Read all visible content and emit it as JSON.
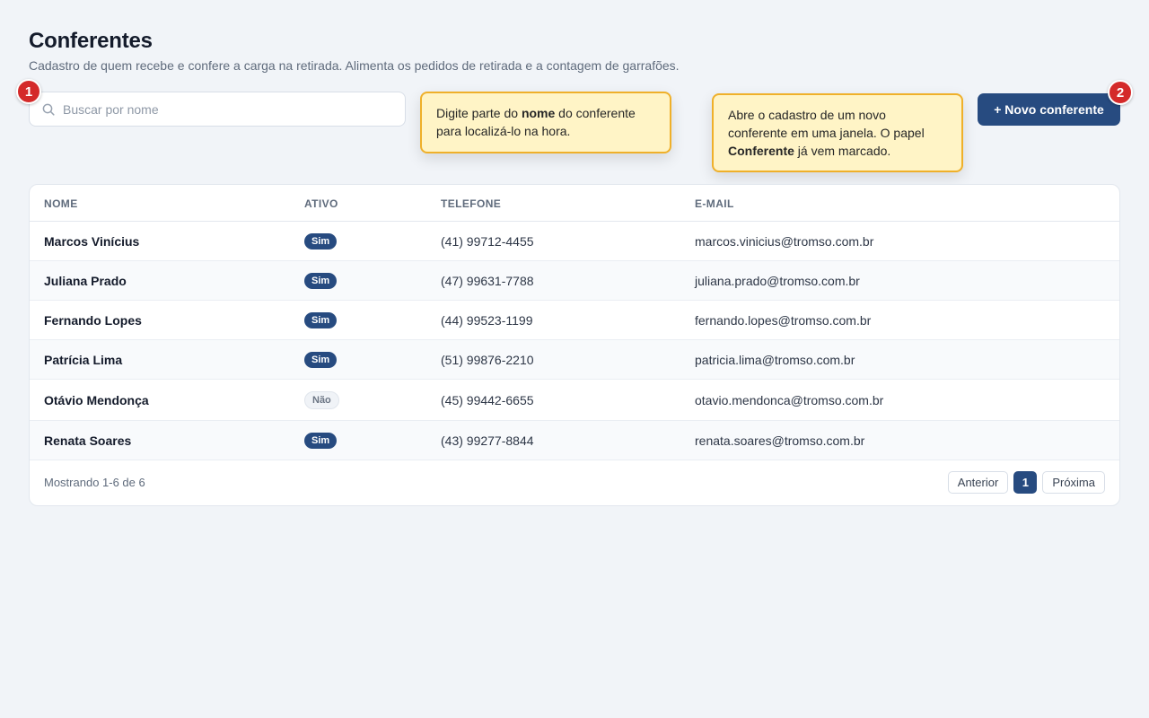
{
  "header": {
    "title": "Conferentes",
    "subtitle": "Cadastro de quem recebe e confere a carga na retirada. Alimenta os pedidos de retirada e a contagem de garrafões."
  },
  "search": {
    "placeholder": "Buscar por nome",
    "value": ""
  },
  "tips": {
    "step1": "1",
    "step2": "2",
    "search_tip": {
      "before": "Digite parte do ",
      "bold": "nome",
      "after": " do conferente para localizá-lo na hora."
    },
    "new_tip": {
      "before": "Abre o cadastro de um novo conferente em uma janela. O papel ",
      "bold": "Conferente",
      "after": " já vem marcado."
    }
  },
  "actions": {
    "new_label": "+ Novo conferente"
  },
  "table": {
    "columns": {
      "name": "NOME",
      "active": "ATIVO",
      "phone": "TELEFONE",
      "email": "E-MAIL"
    },
    "rows": [
      {
        "name": "Marcos Vinícius",
        "active": "Sim",
        "phone": "(41) 99712-4455",
        "email": "marcos.vinicius@tromso.com.br"
      },
      {
        "name": "Juliana Prado",
        "active": "Sim",
        "phone": "(47) 99631-7788",
        "email": "juliana.prado@tromso.com.br"
      },
      {
        "name": "Fernando Lopes",
        "active": "Sim",
        "phone": "(44) 99523-1199",
        "email": "fernando.lopes@tromso.com.br"
      },
      {
        "name": "Patrícia Lima",
        "active": "Sim",
        "phone": "(51) 99876-2210",
        "email": "patricia.lima@tromso.com.br"
      },
      {
        "name": "Otávio Mendonça",
        "active": "Não",
        "phone": "(45) 99442-6655",
        "email": "otavio.mendonca@tromso.com.br"
      },
      {
        "name": "Renata Soares",
        "active": "Sim",
        "phone": "(43) 99277-8844",
        "email": "renata.soares@tromso.com.br"
      }
    ]
  },
  "footer": {
    "showing": "Mostrando 1-6 de 6",
    "prev": "Anterior",
    "page": "1",
    "next": "Próxima"
  },
  "colors": {
    "primary": "#274b80",
    "badge_red": "#d42a2a",
    "tip_bg": "#fff4c6",
    "tip_border": "#efb02a"
  }
}
